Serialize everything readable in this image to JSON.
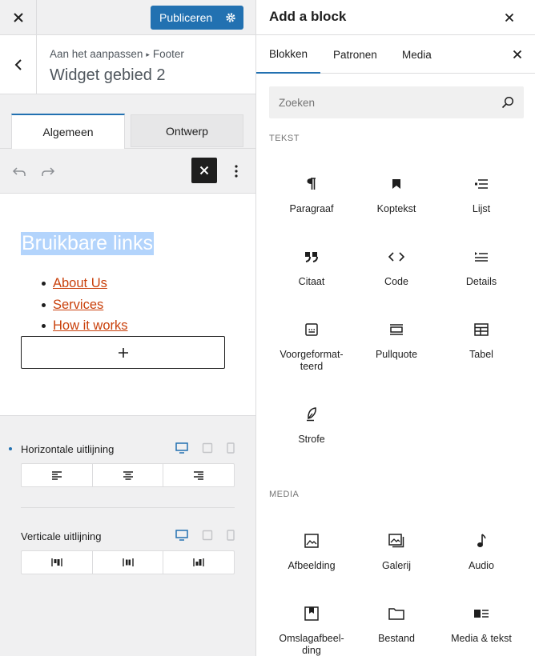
{
  "left": {
    "publish_label": "Publiceren",
    "breadcrumb_parent": "Aan het aanpassen",
    "breadcrumb_sep": "▸",
    "breadcrumb_current": "Footer",
    "widget_title": "Widget gebied 2",
    "tabs": [
      "Algemeen",
      "Ontwerp"
    ],
    "heading": "Bruikbare links",
    "links": [
      "About Us",
      "Services",
      "How it works"
    ],
    "add_block_symbol": "+",
    "settings": {
      "horizontal_label": "Horizontale uitlijning",
      "vertical_label": "Verticale uitlijning"
    }
  },
  "right": {
    "title": "Add a block",
    "tabs": [
      "Blokken",
      "Patronen",
      "Media"
    ],
    "search_placeholder": "Zoeken",
    "cat_text": "TEKST",
    "cat_media": "MEDIA",
    "text_blocks": [
      {
        "label": "Paragraaf",
        "icon": "paragraph-icon"
      },
      {
        "label": "Koptekst",
        "icon": "bookmark-icon"
      },
      {
        "label": "Lijst",
        "icon": "list-icon"
      },
      {
        "label": "Citaat",
        "icon": "quote-icon"
      },
      {
        "label": "Code",
        "icon": "code-icon"
      },
      {
        "label": "Details",
        "icon": "details-icon"
      },
      {
        "label": "Voorgeformat-teerd",
        "line1": "Voorgeformat-",
        "line2": "teerd",
        "icon": "preformatted-icon"
      },
      {
        "label": "Pullquote",
        "icon": "pullquote-icon"
      },
      {
        "label": "Tabel",
        "icon": "table-icon"
      },
      {
        "label": "Strofe",
        "icon": "verse-icon"
      }
    ],
    "media_blocks": [
      {
        "label": "Afbeelding",
        "icon": "image-icon"
      },
      {
        "label": "Galerij",
        "icon": "gallery-icon"
      },
      {
        "label": "Audio",
        "icon": "audio-icon"
      },
      {
        "label": "Omslagafbeel-ding",
        "line1": "Omslagafbeel-",
        "line2": "ding",
        "icon": "cover-icon"
      },
      {
        "label": "Bestand",
        "icon": "file-icon"
      },
      {
        "label": "Media & tekst",
        "icon": "media-text-icon"
      }
    ]
  },
  "colors": {
    "accent": "#2271b1",
    "link": "#c9400b",
    "selection": "#b3d4fc"
  }
}
